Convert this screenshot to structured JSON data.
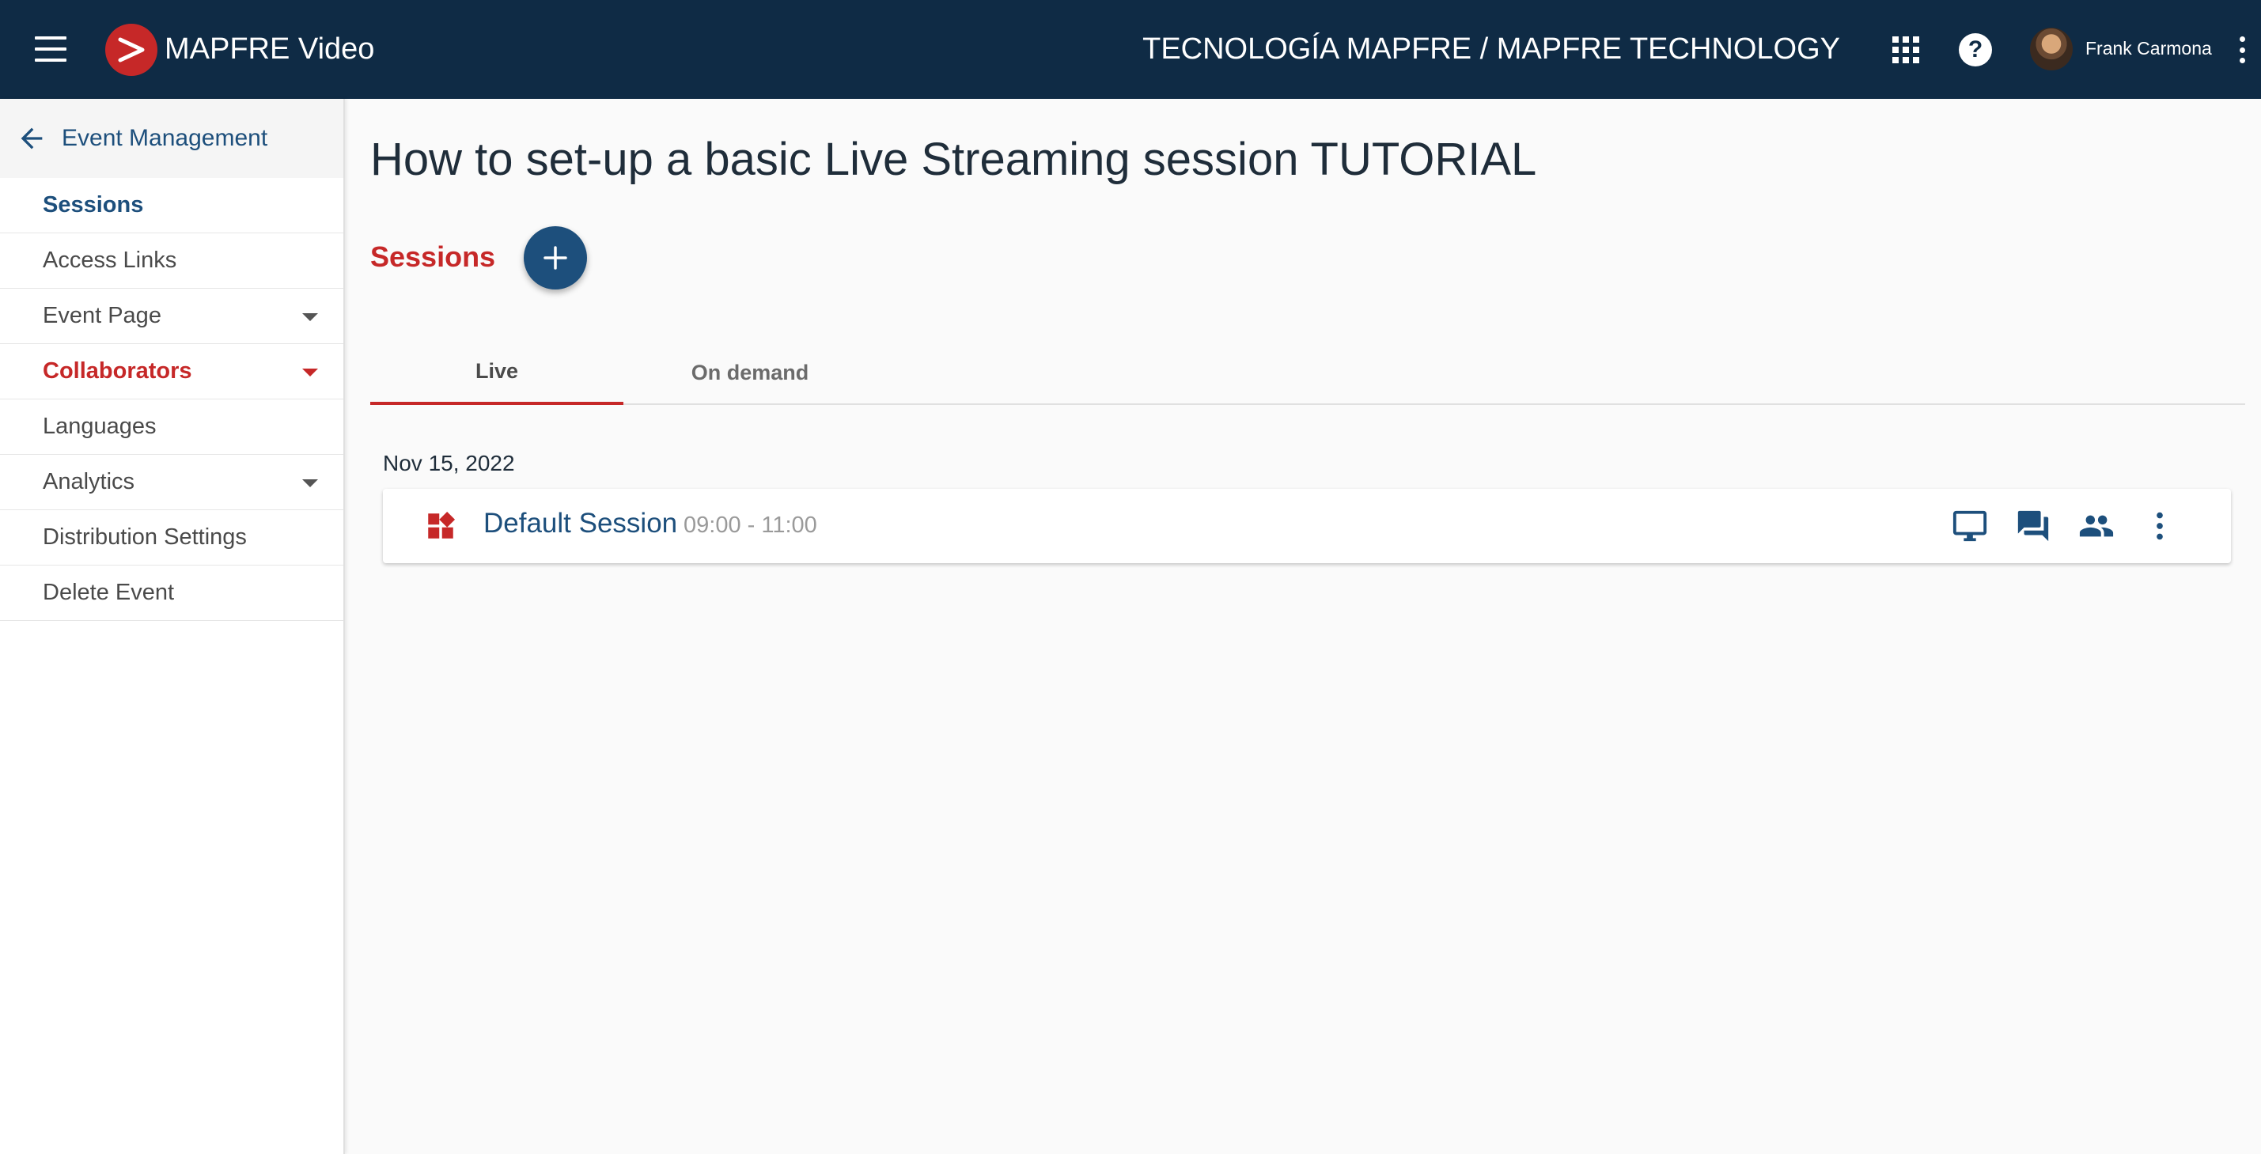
{
  "app": {
    "name": "MAPFRE Video",
    "org_title": "TECNOLOGÍA MAPFRE / MAPFRE TECHNOLOGY",
    "user_name": "Frank Carmona"
  },
  "colors": {
    "topbar": "#0f2b45",
    "brand_red": "#c62828",
    "accent_blue": "#1d4f7c"
  },
  "sidebar": {
    "header_label": "Event Management",
    "items": [
      {
        "label": "Sessions",
        "state": "active"
      },
      {
        "label": "Access Links"
      },
      {
        "label": "Event Page",
        "expandable": true
      },
      {
        "label": "Collaborators",
        "expandable": true,
        "highlight": "red"
      },
      {
        "label": "Languages"
      },
      {
        "label": "Analytics",
        "expandable": true
      },
      {
        "label": "Distribution Settings"
      },
      {
        "label": "Delete Event"
      }
    ]
  },
  "main": {
    "page_title": "How to set-up a basic Live Streaming session TUTORIAL",
    "sessions_heading": "Sessions",
    "tabs": [
      {
        "label": "Live",
        "selected": true
      },
      {
        "label": "On demand",
        "selected": false
      }
    ],
    "date_label": "Nov 15, 2022",
    "sessions": [
      {
        "name": "Default Session",
        "time": "09:00 - 11:00"
      }
    ]
  }
}
